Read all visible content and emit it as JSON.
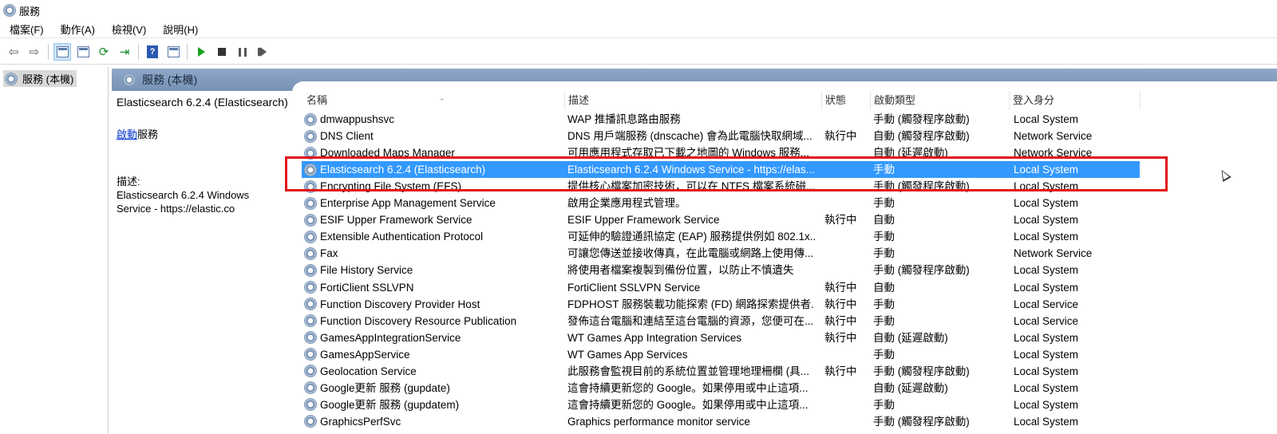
{
  "window": {
    "title": "服務"
  },
  "menu": [
    "檔案(F)",
    "動作(A)",
    "檢視(V)",
    "說明(H)"
  ],
  "tree": {
    "root_label": "服務 (本機)"
  },
  "header": {
    "title": "服務 (本機)"
  },
  "detail": {
    "service_name": "Elasticsearch 6.2.4 (Elasticsearch)",
    "action_link": "啟動",
    "action_suffix": "服務",
    "desc_label": "描述:",
    "desc_line1": "Elasticsearch 6.2.4 Windows",
    "desc_line2": "Service - https://elastic.co"
  },
  "columns": {
    "name": "名稱",
    "desc": "描述",
    "status": "狀態",
    "startup": "啟動類型",
    "logon": "登入身分"
  },
  "services": [
    {
      "name": "dmwappushsvc",
      "desc": "WAP 推播訊息路由服務",
      "status": "",
      "startup": "手動 (觸發程序啟動)",
      "logon": "Local System"
    },
    {
      "name": "DNS Client",
      "desc": "DNS 用戶端服務 (dnscache) 會為此電腦快取網域...",
      "status": "執行中",
      "startup": "自動 (觸發程序啟動)",
      "logon": "Network Service"
    },
    {
      "name": "Downloaded Maps Manager",
      "desc": "可用應用程式存取已下載之地圖的 Windows 服務...",
      "status": "",
      "startup": "自動 (延遲啟動)",
      "logon": "Network Service"
    },
    {
      "name": "Elasticsearch 6.2.4 (Elasticsearch)",
      "desc": "Elasticsearch 6.2.4 Windows Service - https://elas...",
      "status": "",
      "startup": "手動",
      "logon": "Local System"
    },
    {
      "name": "Encrypting File System (EFS)",
      "desc": "提供核心檔案加密技術，可以在 NTFS 檔案系統磁...",
      "status": "",
      "startup": "手動 (觸發程序啟動)",
      "logon": "Local System"
    },
    {
      "name": "Enterprise App Management Service",
      "desc": "啟用企業應用程式管理。",
      "status": "",
      "startup": "手動",
      "logon": "Local System"
    },
    {
      "name": "ESIF Upper Framework Service",
      "desc": "ESIF Upper Framework Service",
      "status": "執行中",
      "startup": "自動",
      "logon": "Local System"
    },
    {
      "name": "Extensible Authentication Protocol",
      "desc": "可延伸的驗證通訊協定 (EAP) 服務提供例如 802.1x...",
      "status": "",
      "startup": "手動",
      "logon": "Local System"
    },
    {
      "name": "Fax",
      "desc": "可讓您傳送並接收傳真，在此電腦或網路上使用傳...",
      "status": "",
      "startup": "手動",
      "logon": "Network Service"
    },
    {
      "name": "File History Service",
      "desc": "將使用者檔案複製到備份位置，以防止不慎遺失",
      "status": "",
      "startup": "手動 (觸發程序啟動)",
      "logon": "Local System"
    },
    {
      "name": "FortiClient SSLVPN",
      "desc": "FortiClient SSLVPN Service",
      "status": "執行中",
      "startup": "自動",
      "logon": "Local System"
    },
    {
      "name": "Function Discovery Provider Host",
      "desc": "FDPHOST 服務裝載功能探索 (FD) 網路探索提供者...",
      "status": "執行中",
      "startup": "手動",
      "logon": "Local Service"
    },
    {
      "name": "Function Discovery Resource Publication",
      "desc": "發佈這台電腦和連結至這台電腦的資源，您便可在...",
      "status": "執行中",
      "startup": "手動",
      "logon": "Local Service"
    },
    {
      "name": "GamesAppIntegrationService",
      "desc": "WT Games App Integration Services",
      "status": "執行中",
      "startup": "自動 (延遲啟動)",
      "logon": "Local System"
    },
    {
      "name": "GamesAppService",
      "desc": "WT Games App Services",
      "status": "",
      "startup": "手動",
      "logon": "Local System"
    },
    {
      "name": "Geolocation Service",
      "desc": "此服務會監視目前的系統位置並管理地理柵欄 (具...",
      "status": "執行中",
      "startup": "手動 (觸發程序啟動)",
      "logon": "Local System"
    },
    {
      "name": "Google更新 服務 (gupdate)",
      "desc": "這會持續更新您的 Google。如果停用或中止這項...",
      "status": "",
      "startup": "自動 (延遲啟動)",
      "logon": "Local System"
    },
    {
      "name": "Google更新 服務 (gupdatem)",
      "desc": "這會持續更新您的 Google。如果停用或中止這項...",
      "status": "",
      "startup": "手動",
      "logon": "Local System"
    },
    {
      "name": "GraphicsPerfSvc",
      "desc": "Graphics performance monitor service",
      "status": "",
      "startup": "手動 (觸發程序啟動)",
      "logon": "Local System"
    }
  ],
  "selected_index": 3,
  "icons": [
    "back-arrow-icon",
    "forward-arrow-icon",
    "console-tree-icon",
    "properties-icon",
    "refresh-icon",
    "export-list-icon",
    "help-icon",
    "show-hide-action-pane-icon",
    "start-icon",
    "stop-icon",
    "pause-icon",
    "restart-icon"
  ]
}
